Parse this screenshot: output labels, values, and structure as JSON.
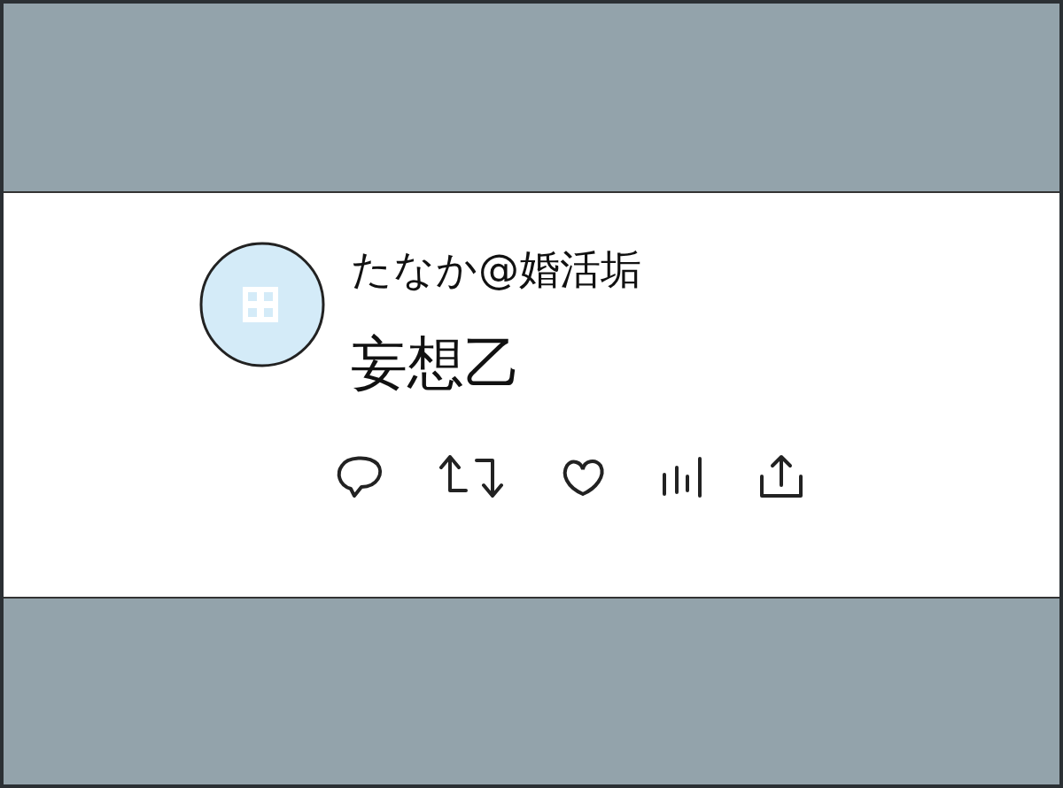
{
  "post": {
    "author": "たなか@婚活垢",
    "text": "妄想乙"
  }
}
